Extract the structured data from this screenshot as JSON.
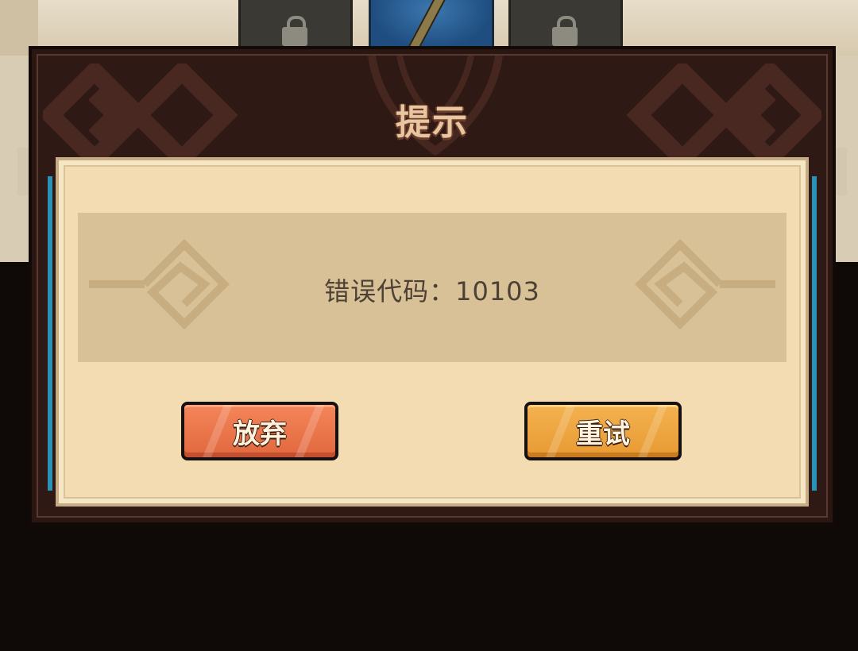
{
  "dialog": {
    "title": "提示",
    "message": "错误代码：10103",
    "buttons": {
      "abandon_label": "放弃",
      "retry_label": "重试"
    }
  },
  "colors": {
    "frame": "#2a1712",
    "panel": "#f3dcb1",
    "message_band": "#d8c196",
    "abandon_button": "#e8703f",
    "retry_button": "#eea63f",
    "accent_border": "#2aa0c8"
  }
}
